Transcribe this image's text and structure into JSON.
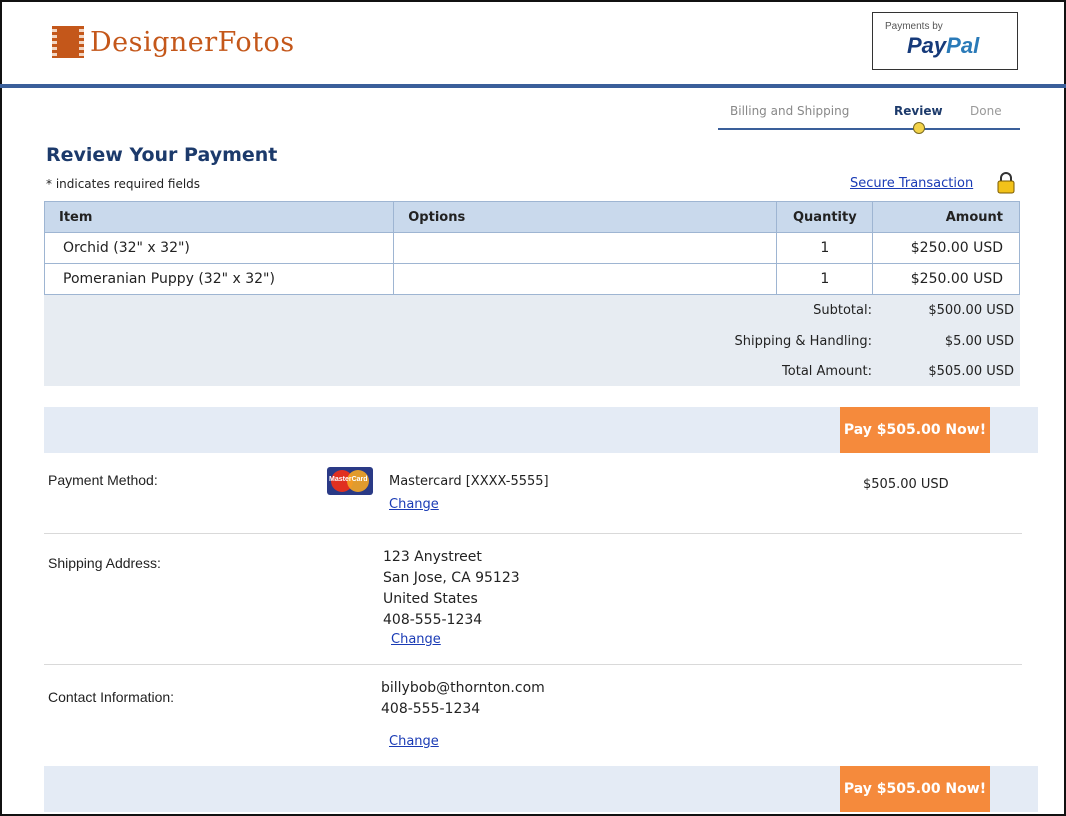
{
  "header": {
    "logo_text": "DesignerFotos",
    "paypal_by": "Payments by",
    "paypal_pay": "Pay",
    "paypal_pal": "Pal"
  },
  "steps": [
    "Billing and Shipping",
    "Review",
    "Done"
  ],
  "page": {
    "title": "Review Your Payment",
    "required_note": "* indicates required fields",
    "secure_link": "Secure Transaction"
  },
  "table": {
    "headers": {
      "item": "Item",
      "options": "Options",
      "quantity": "Quantity",
      "amount": "Amount"
    },
    "rows": [
      {
        "item": "Orchid (32\" x 32\")",
        "options": "",
        "quantity": "1",
        "amount": "$250.00 USD"
      },
      {
        "item": "Pomeranian Puppy (32\" x 32\")",
        "options": "",
        "quantity": "1",
        "amount": "$250.00 USD"
      }
    ]
  },
  "totals": {
    "subtotal_label": "Subtotal:",
    "subtotal": "$500.00 USD",
    "shipping_label": "Shipping & Handling:",
    "shipping": "$5.00 USD",
    "total_label": "Total Amount:",
    "total": "$505.00 USD"
  },
  "pay_button": "Pay $505.00 Now!",
  "payment": {
    "label": "Payment Method:",
    "card_logo_text": "MasterCard",
    "card": "Mastercard [XXXX-5555]",
    "amount": "$505.00 USD",
    "change": "Change"
  },
  "shipping": {
    "label": "Shipping Address:",
    "line1": "123 Anystreet",
    "line2": "San Jose, CA 95123",
    "line3": "United States",
    "phone": "408-555-1234",
    "change": "Change"
  },
  "contact": {
    "label": "Contact Information:",
    "email": "billybob@thornton.com",
    "phone": "408-555-1234",
    "change": "Change"
  },
  "colors": {
    "brand": "#c4571a",
    "primary": "#1c3a6b",
    "button": "#f58a3c",
    "link": "#1a3bb5"
  }
}
